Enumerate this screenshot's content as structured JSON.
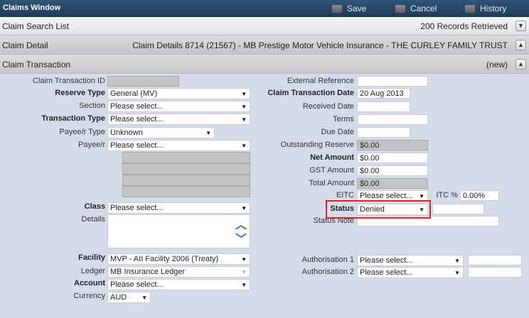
{
  "window": {
    "title": "Claims Window",
    "buttons": {
      "save": "Save",
      "cancel": "Cancel",
      "history": "History"
    }
  },
  "search_bar": {
    "label": "Claim Search List",
    "info": "200 Records Retrieved"
  },
  "detail_bar": {
    "label": "Claim Detail",
    "info": "Claim Details 8714 (21567) - MB Prestige Motor Vehicle Insurance - THE CURLEY FAMILY TRUST"
  },
  "transaction_bar": {
    "label": "Claim Transaction",
    "info": "(new)"
  },
  "form": {
    "claim_transaction_id": {
      "label": "Claim Transaction ID",
      "value": ""
    },
    "reserve_type": {
      "label": "Reserve Type",
      "value": "General (MV)"
    },
    "section": {
      "label": "Section",
      "value": "Please select..."
    },
    "transaction_type": {
      "label": "Transaction Type",
      "value": "Please select..."
    },
    "payee_type": {
      "label": "Payee/r Type",
      "value": "Unknown"
    },
    "payee": {
      "label": "Payee/r",
      "value": "Please select..."
    },
    "class": {
      "label": "Class",
      "value": "Please select..."
    },
    "details": {
      "label": "Details",
      "value": ""
    },
    "facility": {
      "label": "Facility",
      "value": "MVP - AII Facility 2006 (Treaty)"
    },
    "ledger": {
      "label": "Ledger",
      "value": "MB Insurance Ledger"
    },
    "account": {
      "label": "Account",
      "value": "Please select..."
    },
    "currency": {
      "label": "Currency",
      "value": "AUD"
    },
    "external_reference": {
      "label": "External Reference",
      "value": ""
    },
    "claim_transaction_date": {
      "label": "Claim Transaction Date",
      "value": "20 Aug 2013"
    },
    "received_date": {
      "label": "Received Date",
      "value": ""
    },
    "terms": {
      "label": "Terms",
      "value": ""
    },
    "due_date": {
      "label": "Due Date",
      "value": ""
    },
    "outstanding_reserve": {
      "label": "Outstanding Reserve",
      "value": "$0.00"
    },
    "net_amount": {
      "label": "Net Amount",
      "value": "$0.00"
    },
    "gst_amount": {
      "label": "GST Amount",
      "value": "$0.00"
    },
    "total_amount": {
      "label": "Total Amount",
      "value": "$0.00"
    },
    "eitc": {
      "label": "EITC",
      "value": "Please select..."
    },
    "itc_percent": {
      "label": "ITC %",
      "value": "0.00%"
    },
    "status": {
      "label": "Status",
      "value": "Denied",
      "extra": ""
    },
    "status_note": {
      "label": "Status Note",
      "value": ""
    },
    "authorisation1": {
      "label": "Authorisation 1",
      "value": "Please select...",
      "extra": ""
    },
    "authorisation2": {
      "label": "Authorisation 2",
      "value": "Please select...",
      "extra": ""
    }
  },
  "colors": {
    "titlebar": "#1d3c58",
    "highlight": "#d8232a",
    "form_bg": "#d5dce9"
  }
}
